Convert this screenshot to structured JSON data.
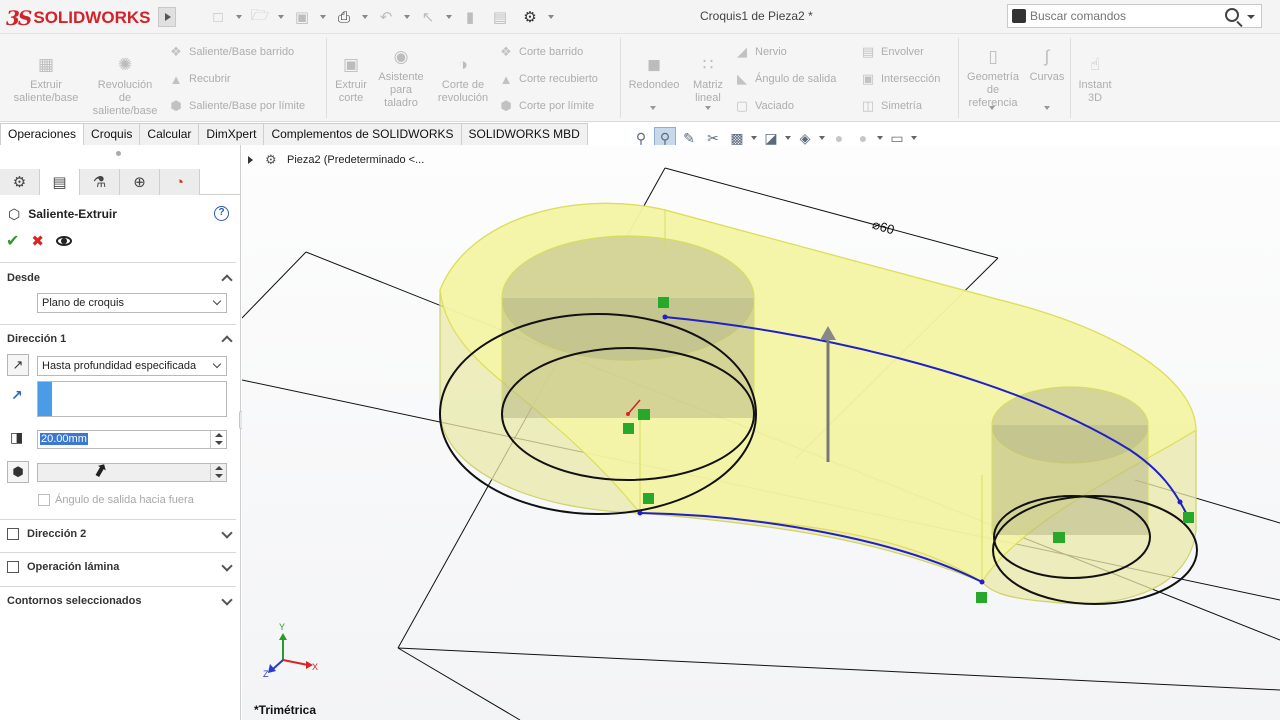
{
  "app": {
    "brand_mark": "3S",
    "brand_name": "SOLIDWORKS",
    "document_title": "Croquis1 de Pieza2 *"
  },
  "search": {
    "placeholder": "Buscar comandos"
  },
  "ribbon": {
    "features": {
      "extruded_boss": "Extruir\nsaliente/base",
      "revolved_boss": "Revolución\nde\nsaliente/base",
      "swept_boss": "Saliente/Base barrido",
      "lofted_boss": "Recubrir",
      "boundary_boss": "Saliente/Base por límite",
      "extruded_cut": "Extruir\ncorte",
      "hole_wizard": "Asistente\npara\ntaladro",
      "revolved_cut": "Corte de\nrevolución",
      "swept_cut": "Corte barrido",
      "lofted_cut": "Corte recubierto",
      "boundary_cut": "Corte por límite",
      "fillet": "Redondeo",
      "linear_pattern": "Matriz\nlineal",
      "rib": "Nervio",
      "draft": "Ángulo de salida",
      "shell": "Vaciado",
      "wrap": "Envolver",
      "intersect": "Intersección",
      "mirror": "Simetría",
      "reference_geometry": "Geometría\nde\nreferencia",
      "curves": "Curvas",
      "instant3d": "Instant\n3D"
    }
  },
  "tabs": [
    {
      "label": "Operaciones",
      "active": true
    },
    {
      "label": "Croquis",
      "active": false
    },
    {
      "label": "Calcular",
      "active": false
    },
    {
      "label": "DimXpert",
      "active": false
    },
    {
      "label": "Complementos de SOLIDWORKS",
      "active": false
    },
    {
      "label": "SOLIDWORKS MBD",
      "active": false
    }
  ],
  "property_manager": {
    "title": "Saliente-Extruir",
    "help": "?",
    "from": {
      "label": "Desde",
      "value": "Plano de croquis"
    },
    "direction1": {
      "label": "Dirección 1",
      "end_condition": "Hasta profundidad especificada",
      "depth": "20.00mm",
      "draft_outward": "Ángulo de salida hacia fuera"
    },
    "direction2": {
      "label": "Dirección 2"
    },
    "thin_feature": {
      "label": "Operación lámina"
    },
    "selected_contours": {
      "label": "Contornos seleccionados"
    }
  },
  "viewport": {
    "tree_item": "Pieza2  (Predeterminado <...",
    "dimension": "⌀60",
    "view_name": "*Trimétrica",
    "triad": {
      "x": "X",
      "y": "Y",
      "z": "Z"
    }
  },
  "colors": {
    "brand_red": "#d2232a",
    "accent_blue": "#2a5aa8",
    "ok_green": "#2f9b2f",
    "cancel_red": "#dd2222",
    "sketch_blue": "#2020c8",
    "preview_yellow": "#f3f39a"
  },
  "icons": {
    "quick_access": [
      "new-document-icon",
      "open-folder-icon",
      "save-icon",
      "print-icon",
      "undo-icon",
      "select-arrow-icon",
      "rebuild-icon",
      "file-properties-icon",
      "options-gear-icon"
    ],
    "view_toolbar": [
      "zoom-to-fit-icon",
      "zoom-area-icon",
      "previous-view-icon",
      "section-view-icon",
      "view-orientation-icon",
      "display-style-icon",
      "hide-show-icon",
      "edit-appearance-icon",
      "apply-scene-icon",
      "view-settings-icon"
    ]
  }
}
